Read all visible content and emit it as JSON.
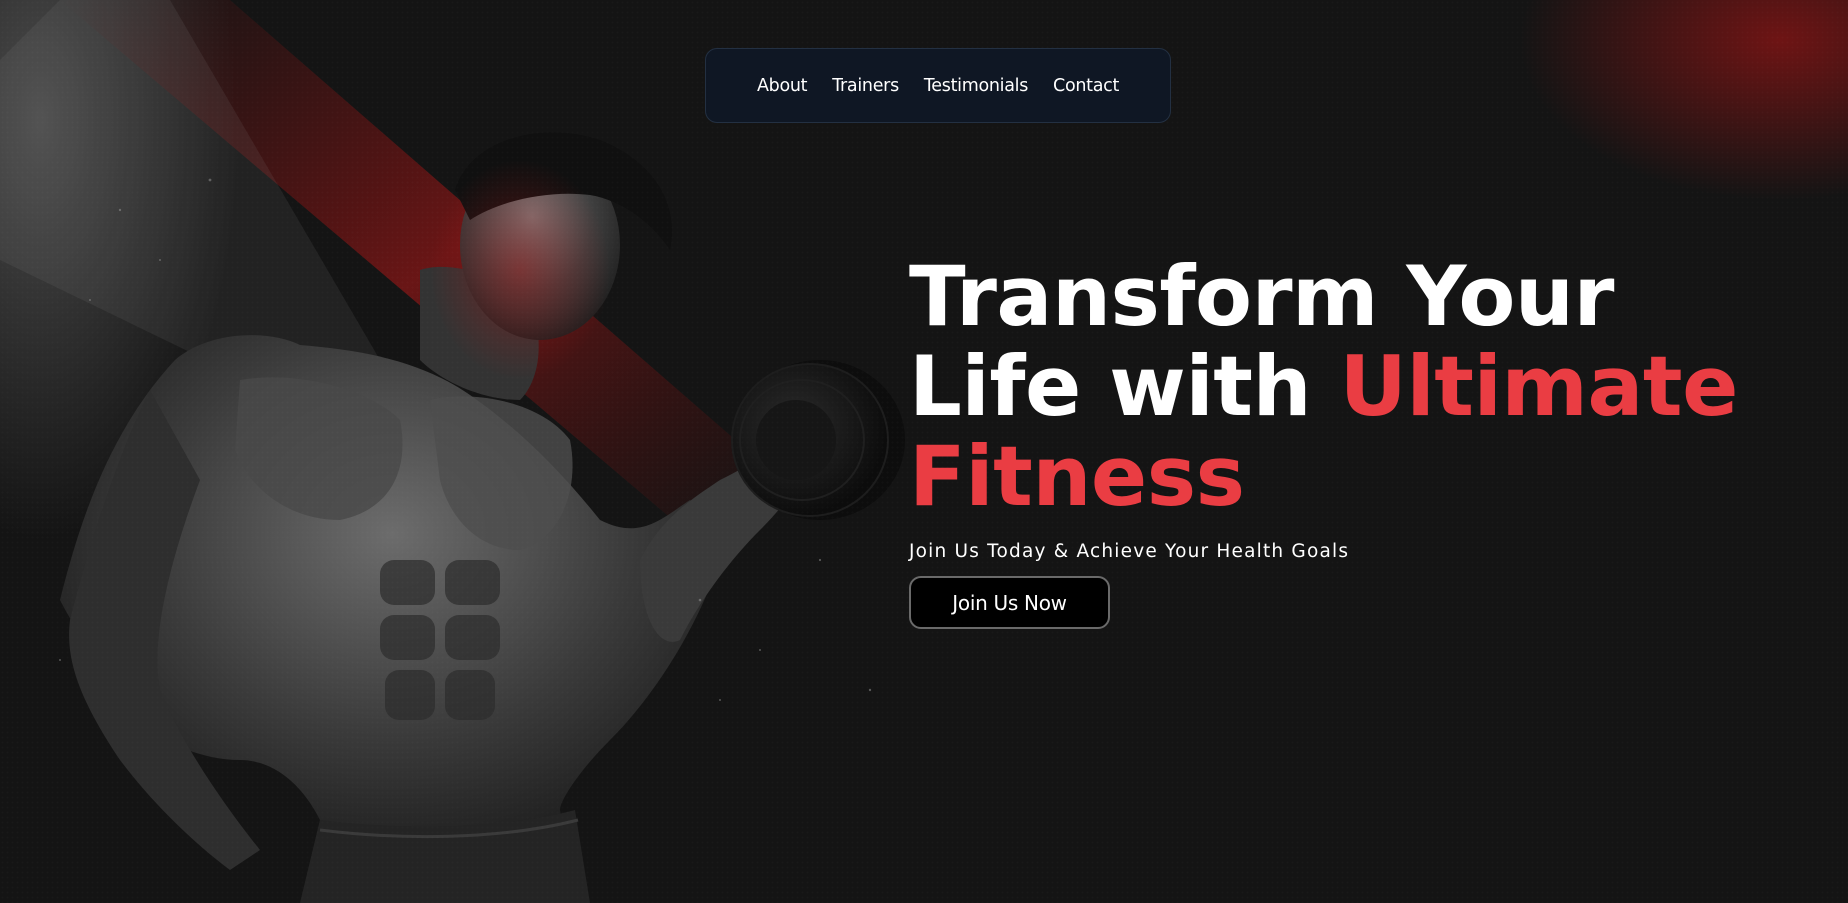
{
  "nav": {
    "items": [
      {
        "label": "About"
      },
      {
        "label": "Trainers"
      },
      {
        "label": "Testimonials"
      },
      {
        "label": "Contact"
      }
    ]
  },
  "hero": {
    "headline_line1": "Transform Your",
    "headline_line2_prefix": "Life with ",
    "headline_line2_accent": "Ultimate",
    "headline_line3_accent": "Fitness",
    "subtitle": "Join Us Today & Achieve Your Health Goals",
    "cta_label": "Join Us Now",
    "image": "muscular-man-with-dumbbell-photo"
  },
  "colors": {
    "background": "#141414",
    "accent": "#ea3d43",
    "nav_background": "#0f1724",
    "text": "#ffffff",
    "button_background": "#000000"
  }
}
